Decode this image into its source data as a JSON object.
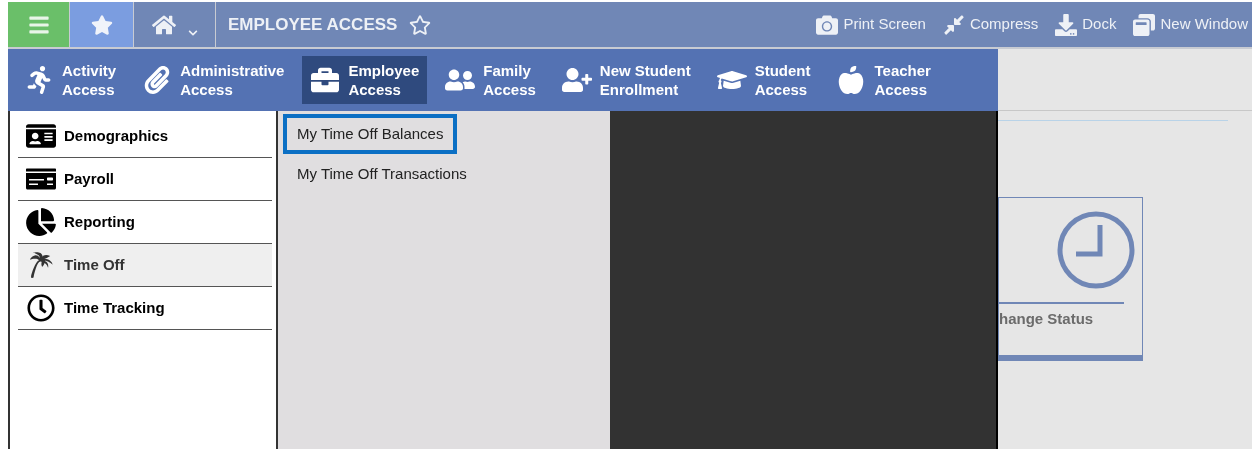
{
  "top_bar": {
    "title": "EMPLOYEE ACCESS",
    "tools": [
      "Print Screen",
      "Compress",
      "Dock",
      "New Window"
    ]
  },
  "modules": [
    {
      "label": "Activity\nAccess",
      "selected": false
    },
    {
      "label": "Administrative\nAccess",
      "selected": false
    },
    {
      "label": "Employee\nAccess",
      "selected": true
    },
    {
      "label": "Family\nAccess",
      "selected": false
    },
    {
      "label": "New Student\nEnrollment",
      "selected": false
    },
    {
      "label": "Student\nAccess",
      "selected": false
    },
    {
      "label": "Teacher\nAccess",
      "selected": false
    }
  ],
  "sidebar": {
    "items": [
      {
        "label": "Demographics",
        "selected": false
      },
      {
        "label": "Payroll",
        "selected": false
      },
      {
        "label": "Reporting",
        "selected": false
      },
      {
        "label": "Time Off",
        "selected": true
      },
      {
        "label": "Time Tracking",
        "selected": false
      }
    ]
  },
  "submenu": {
    "items": [
      {
        "label": "My Time Off Balances",
        "selected": true
      },
      {
        "label": "My Time Off Transactions",
        "selected": false
      }
    ]
  },
  "background_card": {
    "label": "hange Status"
  }
}
